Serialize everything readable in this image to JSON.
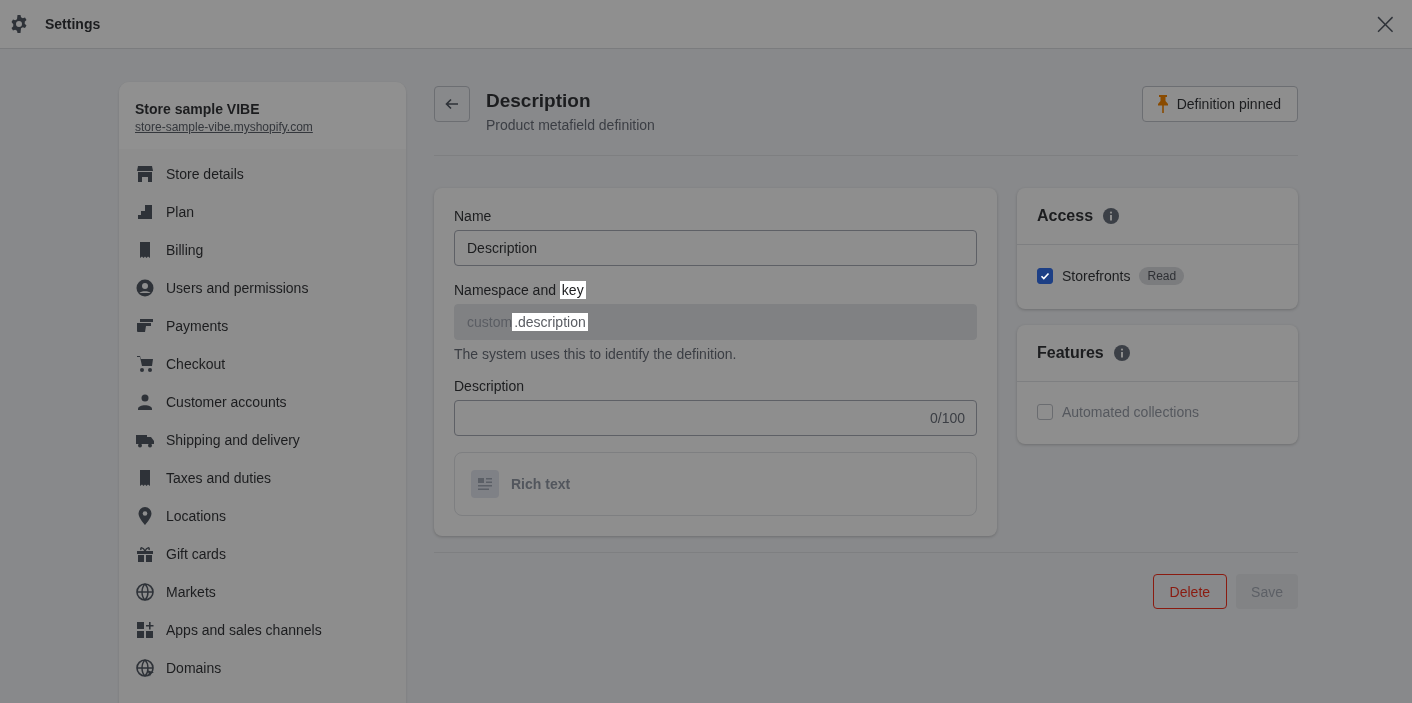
{
  "topbar": {
    "title": "Settings",
    "close": "×"
  },
  "store": {
    "name": "Store sample VIBE",
    "domain": "store-sample-vibe.myshopify.com"
  },
  "sidebar": {
    "items": [
      {
        "label": "Store details",
        "selected": false
      },
      {
        "label": "Plan",
        "selected": false
      },
      {
        "label": "Billing",
        "selected": false
      },
      {
        "label": "Users and permissions",
        "selected": false
      },
      {
        "label": "Payments",
        "selected": false
      },
      {
        "label": "Checkout",
        "selected": false
      },
      {
        "label": "Customer accounts",
        "selected": false
      },
      {
        "label": "Shipping and delivery",
        "selected": false
      },
      {
        "label": "Taxes and duties",
        "selected": false
      },
      {
        "label": "Locations",
        "selected": false
      },
      {
        "label": "Gift cards",
        "selected": false
      },
      {
        "label": "Markets",
        "selected": false
      },
      {
        "label": "Apps and sales channels",
        "selected": false
      },
      {
        "label": "Domains",
        "selected": false
      }
    ]
  },
  "header": {
    "title": "Description",
    "subtitle": "Product metafield definition",
    "pin_button": "Definition pinned"
  },
  "form": {
    "name": {
      "label": "Name",
      "value": "Description"
    },
    "namespace": {
      "label": [
        {
          "text": "Namespace and ",
          "highlighted": false
        },
        {
          "text": "key",
          "highlighted": true
        }
      ],
      "value": [
        {
          "text": "custom",
          "highlighted": false
        },
        {
          "text": ".description",
          "highlighted": true
        }
      ],
      "disabled": true,
      "help": "The system uses this to identify the definition."
    },
    "description": {
      "label": "Description",
      "counter": "0/100"
    },
    "type": {
      "label": "Rich text"
    }
  },
  "access": {
    "title": "Access",
    "items": [
      {
        "label": "Storefronts",
        "checked": true,
        "disabled": false,
        "badge": "Read"
      }
    ]
  },
  "features": {
    "title": "Features",
    "items": [
      {
        "label": "Automated collections",
        "checked": false,
        "disabled": true
      }
    ]
  },
  "actions": {
    "delete": "Delete",
    "save": {
      "label": "Save",
      "disabled": true
    }
  }
}
